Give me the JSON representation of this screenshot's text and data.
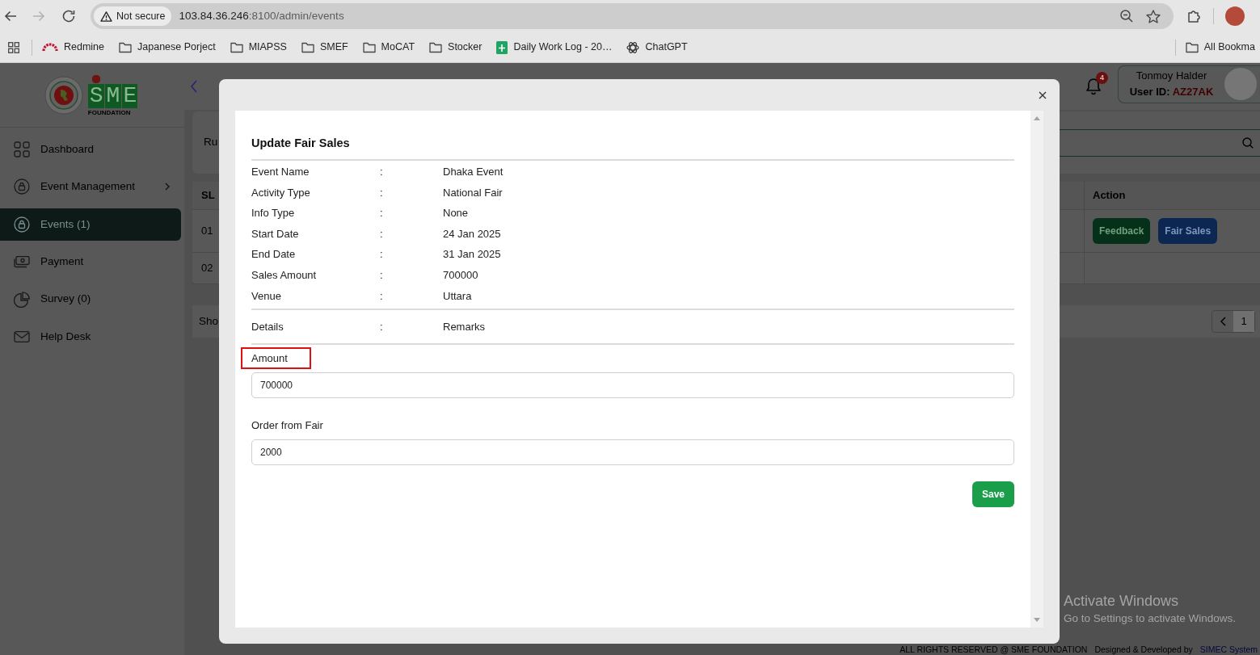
{
  "browser": {
    "can_go_forward": false,
    "security_label": "Not secure",
    "url_host": "103.84.36.246",
    "url_path": ":8100/admin/events",
    "bookmarks": [
      {
        "label": "Redmine",
        "kind": "half-ring"
      },
      {
        "label": "Japanese Porject",
        "kind": "folder"
      },
      {
        "label": "MIAPSS",
        "kind": "folder"
      },
      {
        "label": "SMEF",
        "kind": "folder"
      },
      {
        "label": "MoCAT",
        "kind": "folder"
      },
      {
        "label": "Stocker",
        "kind": "folder"
      },
      {
        "label": "Daily Work Log - 20…",
        "kind": "sheet"
      },
      {
        "label": "ChatGPT",
        "kind": "knot"
      }
    ],
    "all_bookmarks": "All Bookma"
  },
  "sidebar": {
    "logo": {
      "wordmark": "SME",
      "tagline": "FOUNDATION"
    },
    "items": [
      {
        "label": "Dashboard",
        "kind": "grid",
        "has_submenu": false,
        "selected": false
      },
      {
        "label": "Event Management",
        "kind": "lock",
        "has_submenu": true,
        "selected": false
      },
      {
        "label": "Events (1)",
        "kind": "lock",
        "has_submenu": false,
        "selected": true
      },
      {
        "label": "Payment",
        "kind": "cash",
        "has_submenu": false,
        "selected": false
      },
      {
        "label": "Survey (0)",
        "kind": "pie",
        "has_submenu": false,
        "selected": false
      },
      {
        "label": "Help Desk",
        "kind": "mail",
        "has_submenu": false,
        "selected": false
      }
    ]
  },
  "header": {
    "notification_count": "4",
    "user_name": "Tonmoy Halder",
    "user_id_label": "User ID:",
    "user_id": "AZ27AK"
  },
  "content": {
    "tab_label": "Ru",
    "table": {
      "columns": [
        "SL",
        "Action"
      ],
      "rows": [
        {
          "sl": "01",
          "actions": [
            {
              "label": "Feedback",
              "kind": "success"
            },
            {
              "label": "Fair Sales",
              "kind": "primary"
            }
          ]
        },
        {
          "sl": "02"
        }
      ]
    },
    "pagination": {
      "summary": "Sho",
      "pages": [
        {
          "label": "1",
          "selected": true
        }
      ]
    }
  },
  "footer": {
    "copyright": "ALL RIGHTS RESERVED @ SME FOUNDATION",
    "credit": "Designed & Developed by",
    "developer": "SIMEC System"
  },
  "modal": {
    "title": "Update Fair Sales",
    "details": [
      {
        "label": "Event Name",
        "separator": ":",
        "value": "Dhaka Event"
      },
      {
        "label": "Activity Type",
        "separator": ":",
        "value": "National Fair"
      },
      {
        "label": "Info Type",
        "separator": ":",
        "value": "None"
      },
      {
        "label": "Start Date",
        "separator": ":",
        "value": "24 Jan 2025"
      },
      {
        "label": "End Date",
        "separator": ":",
        "value": "31 Jan 2025"
      },
      {
        "label": "Sales Amount",
        "separator": ":",
        "value": "700000"
      },
      {
        "label": "Venue",
        "separator": ":",
        "value": "Uttara"
      }
    ],
    "remarks": {
      "label": "Details",
      "separator": ":",
      "value": "Remarks"
    },
    "fields": [
      {
        "label": "Amount",
        "value": "700000",
        "highlighted": true
      },
      {
        "label": "Order from Fair",
        "value": "2000",
        "highlighted": false
      }
    ],
    "save_label": "Save"
  },
  "os_notice": {
    "title": "Activate Windows",
    "message": "Go to Settings to activate Windows."
  }
}
